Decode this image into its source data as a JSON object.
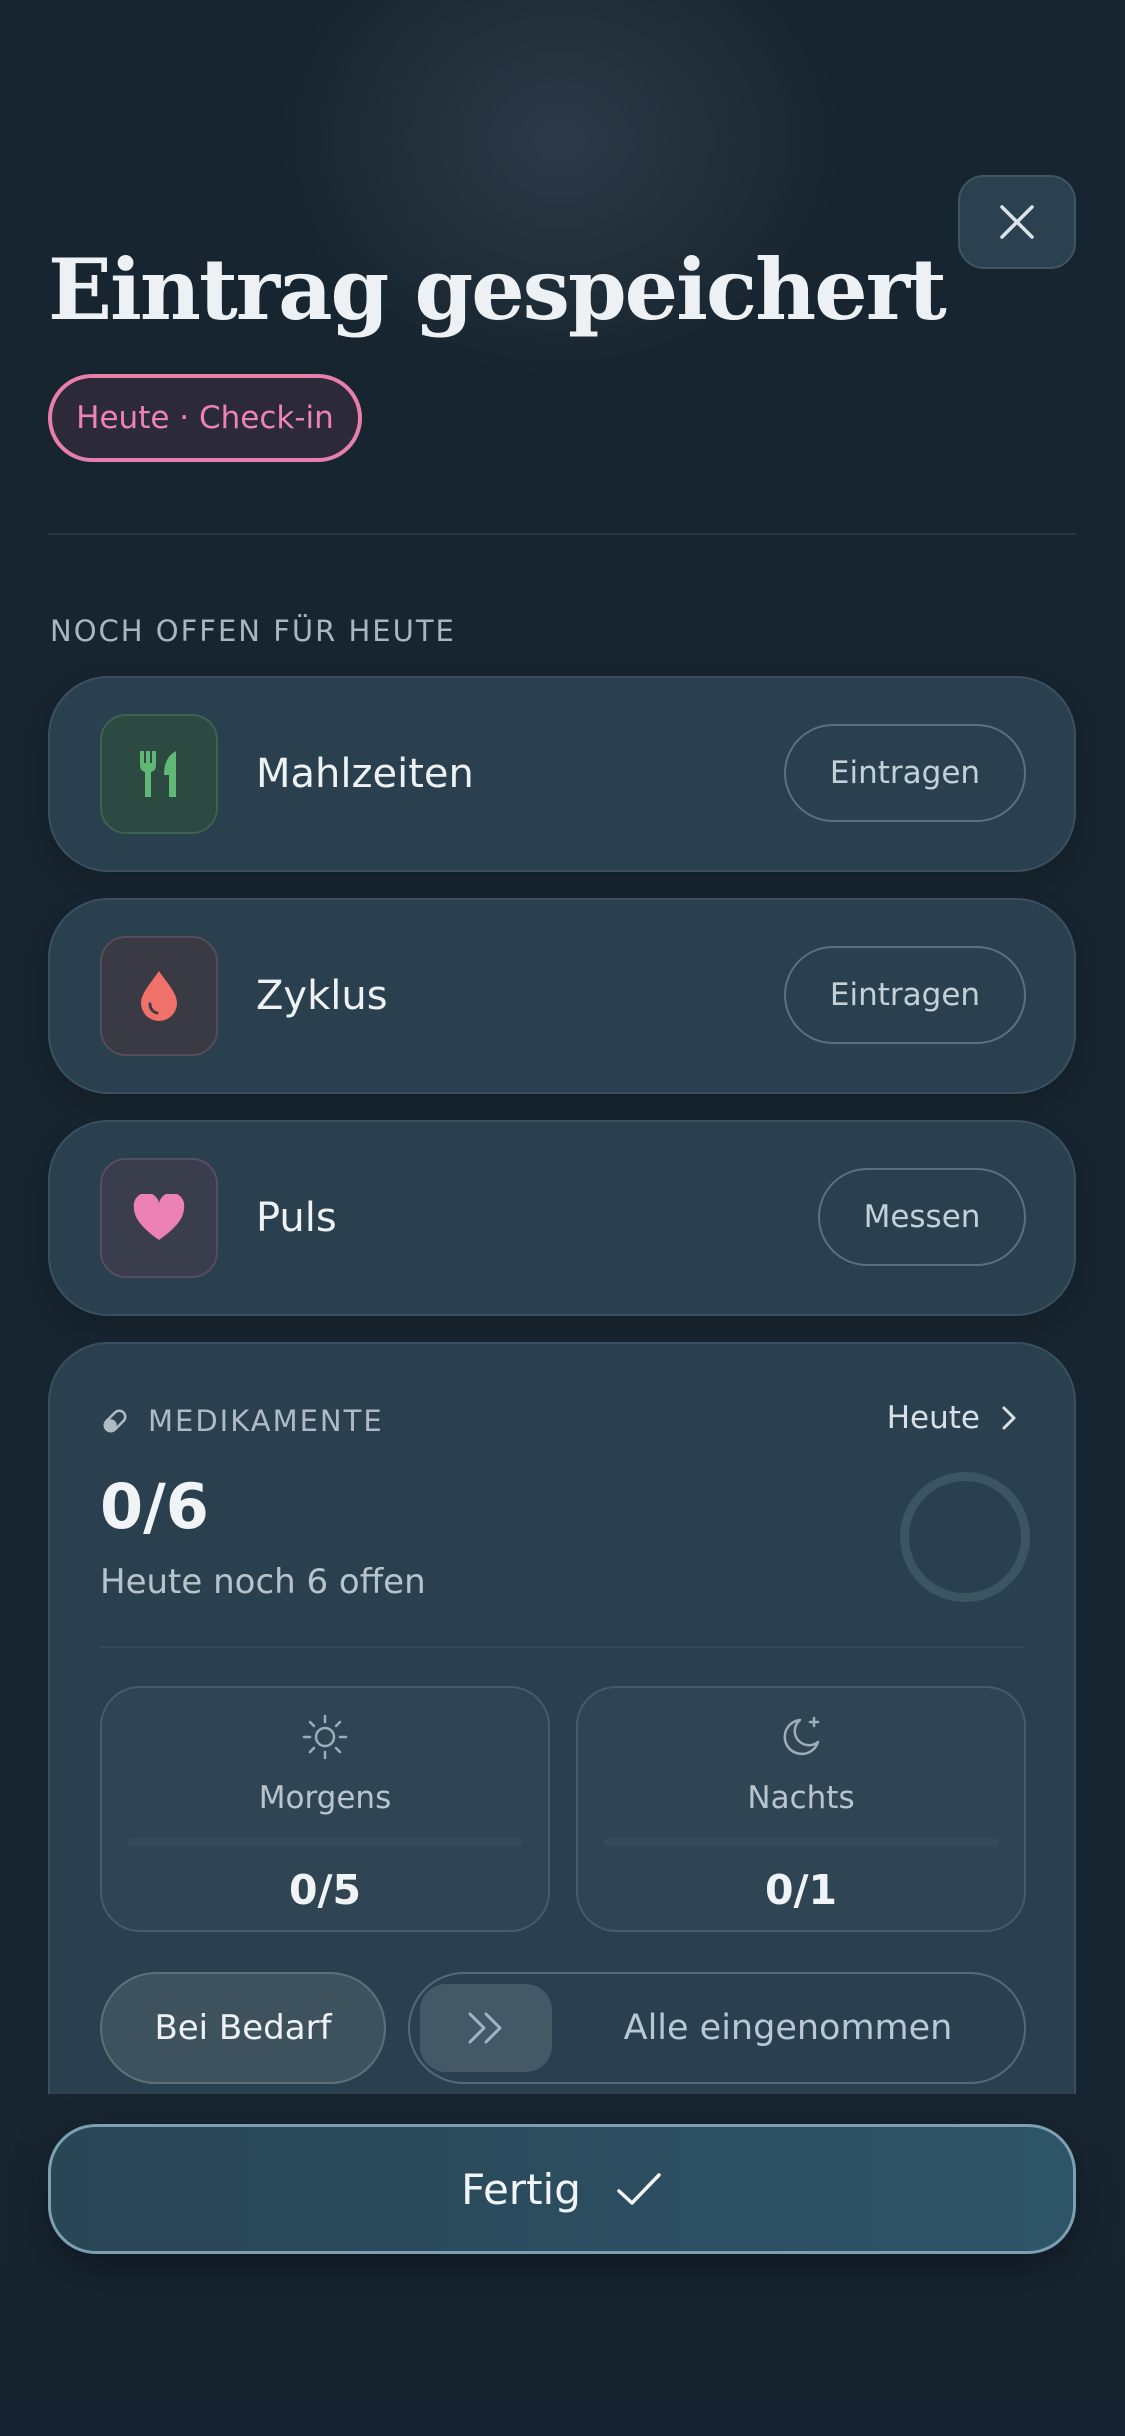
{
  "header": {
    "title": "Eintrag gespeichert",
    "tag": "Heute · Check-in",
    "close_icon": "close-icon"
  },
  "open_section": {
    "label": "NOCH OFFEN FÜR HEUTE",
    "items": [
      {
        "label": "Mahlzeiten",
        "action": "Eintragen",
        "icon": "fork-knife-icon",
        "color": "#5fb873"
      },
      {
        "label": "Zyklus",
        "action": "Eintragen",
        "icon": "drop-icon",
        "color": "#f0706a"
      },
      {
        "label": "Puls",
        "action": "Messen",
        "icon": "heart-icon",
        "color": "#ec82b4"
      }
    ]
  },
  "medication": {
    "label": "MEDIKAMENTE",
    "link": "Heute",
    "count": "0/6",
    "subtitle": "Heute noch 6 offen",
    "progress": 0,
    "slots": [
      {
        "label": "Morgens",
        "value": "0/5",
        "icon": "sun-icon"
      },
      {
        "label": "Nachts",
        "value": "0/1",
        "icon": "moon-icon"
      }
    ],
    "as_needed": "Bei Bedarf",
    "swipe_label": "Alle eingenommen"
  },
  "footer": {
    "done_label": "Fertig",
    "done_icon": "check-icon"
  },
  "colors": {
    "background": "#172530",
    "card": "#2b404e",
    "accent_pink": "#e77fad"
  }
}
